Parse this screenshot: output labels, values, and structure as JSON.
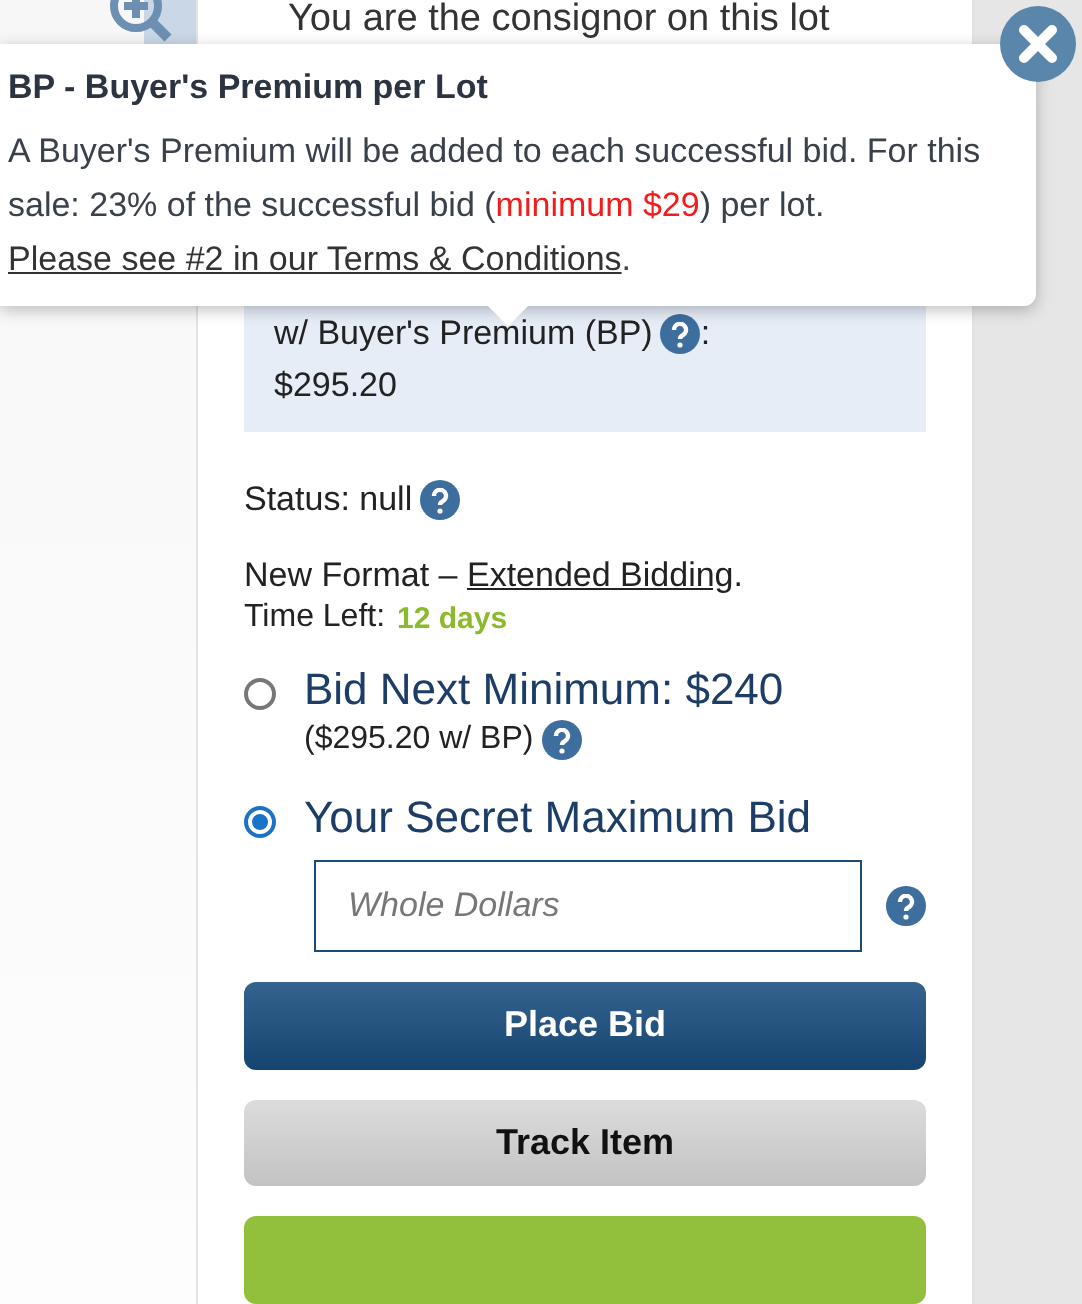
{
  "consignor_notice": "You are the consignor on this lot",
  "tooltip": {
    "title": "BP - Buyer's Premium per Lot",
    "text_before": "A Buyer's Premium will be added to each successful bid. For this sale: 23% of the successful bid (",
    "highlight": "minimum $29",
    "text_after": ") per lot. ",
    "link": "Please see #2 in our Terms & Conditions",
    "text_end": "."
  },
  "premium_box": {
    "label": "w/ Buyer's Premium (BP)",
    "label_suffix": ":",
    "amount": "$295.20"
  },
  "status": {
    "text": "Status: null"
  },
  "format": {
    "prefix": "New Format – ",
    "link": "Extended Bidding",
    "suffix": ".",
    "time_label": "Time Left:",
    "time_value": "12 days"
  },
  "bid_options": [
    {
      "label": "Bid Next Minimum: $240",
      "sub": "($295.20 w/ BP)",
      "selected": false
    },
    {
      "label": "Your Secret Maximum Bid",
      "selected": true
    }
  ],
  "bid_input": {
    "placeholder": "Whole Dollars"
  },
  "buttons": [
    {
      "label": "Place Bid",
      "kind": "primary"
    },
    {
      "label": "Track Item",
      "kind": "secondary"
    },
    {
      "kind": "success"
    }
  ]
}
